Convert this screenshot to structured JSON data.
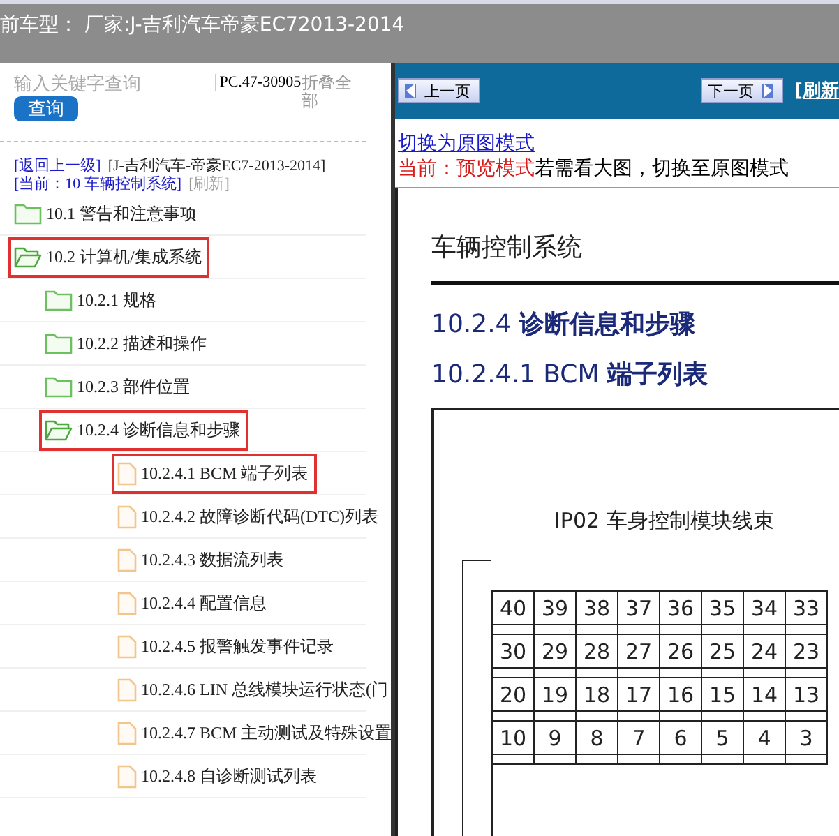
{
  "title_bar": {
    "title": "前车型： 厂家:J-吉利汽车帝豪EC72013-2014"
  },
  "sidebar": {
    "search": {
      "placeholder": "输入关键字查询"
    },
    "search_button": "查询",
    "code": "PC.47-30905",
    "collapse_all": "折叠全部",
    "breadcrumb": {
      "back": "[返回上一级]",
      "vehicle": "[J-吉利汽车-帝豪EC7-2013-2014]",
      "current": "[当前：10 车辆控制系统]",
      "refresh": "[刷新]"
    },
    "tree": [
      {
        "label": "10.1 警告和注意事项",
        "kind": "folder",
        "expanded": false,
        "highlighted": false
      },
      {
        "label": "10.2 计算机/集成系统",
        "kind": "folder",
        "expanded": true,
        "highlighted": true,
        "children": [
          {
            "label": "10.2.1 规格",
            "kind": "folder",
            "expanded": false,
            "highlighted": false
          },
          {
            "label": "10.2.2 描述和操作",
            "kind": "folder",
            "expanded": false,
            "highlighted": false
          },
          {
            "label": "10.2.3 部件位置",
            "kind": "folder",
            "expanded": false,
            "highlighted": false
          },
          {
            "label": "10.2.4 诊断信息和步骤",
            "kind": "folder",
            "expanded": true,
            "highlighted": true,
            "children": [
              {
                "label": "10.2.4.1 BCM 端子列表",
                "kind": "file",
                "highlighted": true
              },
              {
                "label": "10.2.4.2 故障诊断代码(DTC)列表",
                "kind": "file",
                "highlighted": false
              },
              {
                "label": "10.2.4.3 数据流列表",
                "kind": "file",
                "highlighted": false
              },
              {
                "label": "10.2.4.4 配置信息",
                "kind": "file",
                "highlighted": false
              },
              {
                "label": "10.2.4.5 报警触发事件记录",
                "kind": "file",
                "highlighted": false
              },
              {
                "label": "10.2.4.6 LIN 总线模块运行状态(门",
                "kind": "file",
                "highlighted": false
              },
              {
                "label": "10.2.4.7 BCM 主动测试及特殊设置",
                "kind": "file",
                "highlighted": false
              },
              {
                "label": "10.2.4.8 自诊断测试列表",
                "kind": "file",
                "highlighted": false
              }
            ]
          }
        ]
      }
    ]
  },
  "viewer": {
    "prev_button": "上一页",
    "next_button": "下一页",
    "refresh": "[刷新",
    "switch_link": "切换为原图模式",
    "mode_label": "当前：预览模式",
    "mode_hint": "若需看大图，切换至原图模式",
    "document": {
      "header": "车辆控制系统",
      "heading_1": "10.2.4 **诊断信息和步骤**",
      "heading_2": "10.2.4.1 BCM **端子列表**",
      "figure_caption": "IP02 车身控制模块线束",
      "connector_rows": [
        [
          "40",
          "39",
          "38",
          "37",
          "36",
          "35",
          "34",
          "33"
        ],
        [
          "30",
          "29",
          "28",
          "27",
          "26",
          "25",
          "24",
          "23"
        ],
        [
          "20",
          "19",
          "18",
          "17",
          "16",
          "15",
          "14",
          "13"
        ],
        [
          "10",
          "9",
          "8",
          "7",
          "6",
          "5",
          "4",
          "3"
        ]
      ]
    }
  }
}
